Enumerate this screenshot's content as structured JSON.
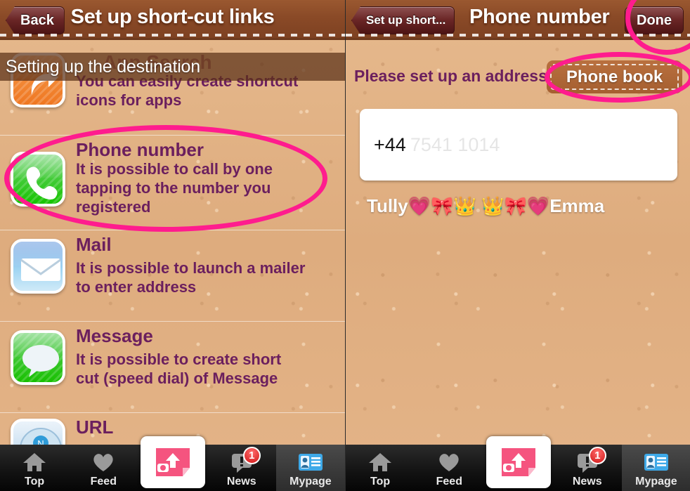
{
  "left": {
    "nav": {
      "back_label": "Back",
      "title": "Set up short-cut links"
    },
    "overlay_banner": "Setting up the destination",
    "section_title": "App Search",
    "items": [
      {
        "icon": "share-arrow-icon",
        "title": "",
        "desc": "You can easily create shortcut icons for apps"
      },
      {
        "icon": "phone-handset-icon",
        "title": "Phone number",
        "desc": "It is possible to call by one tapping to the number you registered"
      },
      {
        "icon": "mail-envelope-icon",
        "title": "Mail",
        "desc": "It is possible to launch a mailer to enter address"
      },
      {
        "icon": "message-bubble-icon",
        "title": "Message",
        "desc": "It is possible to create short cut (speed dial) of Message"
      },
      {
        "icon": "safari-compass-icon",
        "title": "URL",
        "desc": ""
      }
    ]
  },
  "right": {
    "nav": {
      "back_label": "Set up short...",
      "title": "Phone number",
      "done_label": "Done"
    },
    "hint": "Please set up an address.",
    "phone_book_label": "Phone book",
    "input": {
      "value": "+44",
      "placeholder": "7541 1014"
    },
    "contact_name": "Tully💗🎀👑 👑🎀💗Emma"
  },
  "tabbar": {
    "tabs": [
      {
        "label": "Top",
        "icon": "home-icon",
        "selected": false,
        "badge": ""
      },
      {
        "label": "Feed",
        "icon": "heart-icon",
        "selected": false,
        "badge": ""
      },
      {
        "label": "",
        "icon": "camera-upload-icon",
        "selected": false,
        "badge": ""
      },
      {
        "label": "News",
        "icon": "speech-bubble-alert-icon",
        "selected": false,
        "badge": "1"
      },
      {
        "label": "Mypage",
        "icon": "contact-card-icon",
        "selected": true,
        "badge": ""
      }
    ]
  },
  "colors": {
    "header_brown": "#8a4a27",
    "paper_tan": "#e3b488",
    "purple_text": "#6b1f5e",
    "annotation_pink": "#ff1c8e",
    "accent_pink": "#f5547f"
  }
}
